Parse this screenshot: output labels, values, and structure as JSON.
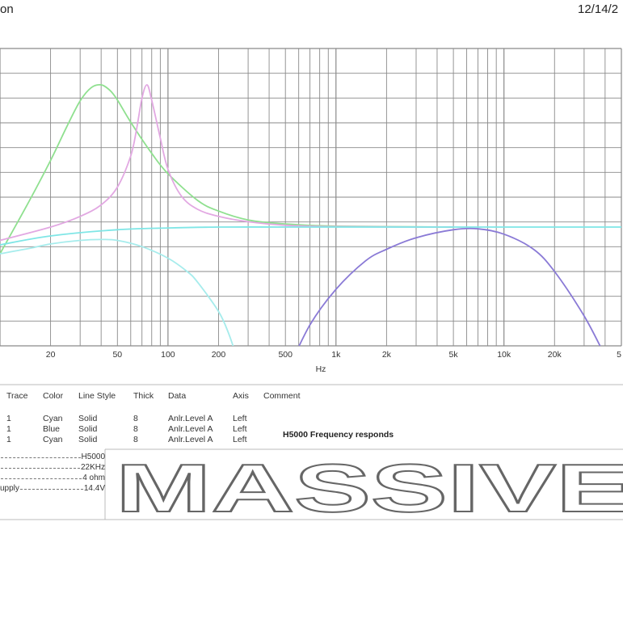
{
  "header": {
    "left_text": "on",
    "right_text": "12/14/2"
  },
  "chart_data": {
    "type": "line",
    "xlabel": "Hz",
    "x_scale": "log",
    "xlim": [
      10,
      50000
    ],
    "grid": true,
    "x_tick_labels": [
      "20",
      "50",
      "100",
      "200",
      "500",
      "1k",
      "2k",
      "5k",
      "10k",
      "20k",
      "5"
    ],
    "x_tick_values": [
      20,
      50,
      100,
      200,
      500,
      1000,
      2000,
      5000,
      10000,
      20000,
      50000
    ],
    "series": [
      {
        "color": "#8fe08f",
        "x": [
          10,
          15,
          20,
          25,
          30,
          35,
          40,
          45,
          50,
          60,
          80,
          100,
          150,
          200,
          300,
          500,
          1000,
          5000
        ],
        "y": [
          -3,
          3,
          7.5,
          11.3,
          14.2,
          15.7,
          16,
          15.4,
          14.3,
          11.8,
          8.3,
          6,
          3,
          1.8,
          0.8,
          0.35,
          0.1,
          0
        ]
      },
      {
        "color": "#e2a8e2",
        "x": [
          10,
          20,
          30,
          40,
          50,
          60,
          65,
          70,
          75,
          80,
          90,
          100,
          120,
          150,
          200,
          300,
          500,
          1000,
          5000
        ],
        "y": [
          -1.5,
          0,
          1.2,
          2.5,
          4.5,
          8,
          11,
          14.5,
          16,
          14.3,
          10,
          6.5,
          3.5,
          2,
          1.2,
          0.6,
          0.2,
          0.05,
          0
        ]
      },
      {
        "color": "#7fe6e6",
        "x": [
          10,
          20,
          50,
          100,
          200,
          500,
          1000,
          5000,
          10000,
          50000
        ],
        "y": [
          -2,
          -1,
          -0.3,
          -0.1,
          0,
          0,
          0,
          0,
          0,
          0
        ]
      },
      {
        "color": "#a6ecec",
        "x": [
          10,
          15,
          20,
          30,
          40,
          50,
          70,
          100,
          130,
          150,
          200,
          230,
          260,
          280
        ],
        "y": [
          -3,
          -2.4,
          -1.9,
          -1.5,
          -1.4,
          -1.5,
          -2.2,
          -3.5,
          -5,
          -6.2,
          -9.5,
          -12,
          -15,
          -17
        ]
      },
      {
        "color": "#8a7ad6",
        "x": [
          420,
          500,
          700,
          1000,
          1500,
          2000,
          3000,
          5000,
          7000,
          10000,
          15000,
          20000,
          30000,
          40000,
          50000
        ],
        "y": [
          -18,
          -16.5,
          -11,
          -7,
          -3.8,
          -2.5,
          -1.2,
          -0.3,
          -0.2,
          -0.8,
          -2.5,
          -5,
          -10,
          -14.5,
          -18
        ]
      }
    ]
  },
  "table": {
    "headers": [
      "Trace",
      "Color",
      "Line Style",
      "Thick",
      "Data",
      "Axis",
      "Comment"
    ],
    "rows": [
      [
        "1",
        "Cyan",
        "Solid",
        "8",
        "Anlr.Level A",
        "Left"
      ],
      [
        "1",
        "Blue",
        "Solid",
        "8",
        "Anlr.Level A",
        "Left"
      ],
      [
        "1",
        "Cyan",
        "Solid",
        "8",
        "Anlr.Level A",
        "Left"
      ]
    ],
    "comment": "H5000 Frequency responds"
  },
  "specs": [
    {
      "label": "",
      "value": "H5000"
    },
    {
      "label": "",
      "value": "22KHz"
    },
    {
      "label": "",
      "value": "4 ohm"
    },
    {
      "label": "upply",
      "value": "14.4V"
    }
  ],
  "brand": {
    "logo_text": "MASSIVE"
  }
}
